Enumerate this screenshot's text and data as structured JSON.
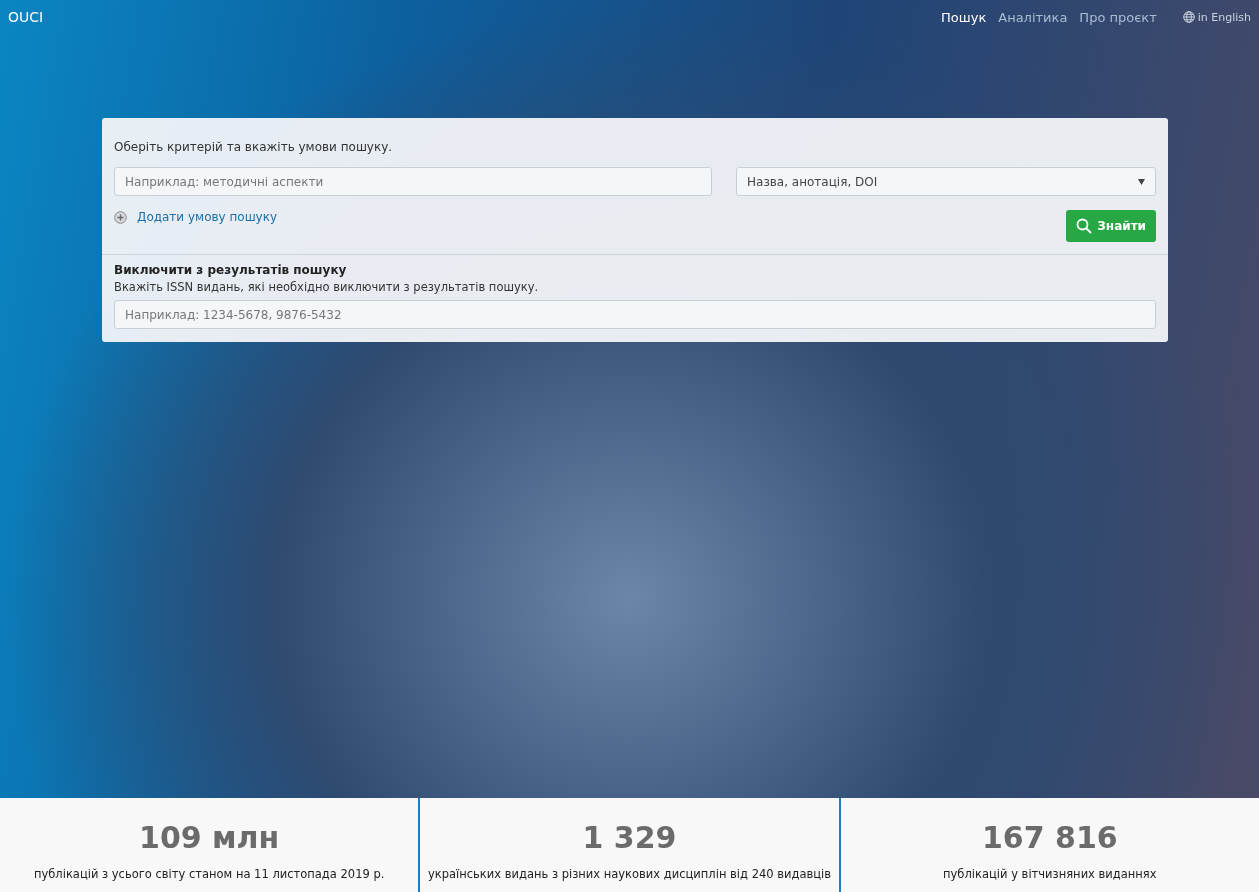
{
  "brand": "OUCI",
  "nav": [
    {
      "label": "Пошук",
      "selected": true
    },
    {
      "label": "Аналітика",
      "selected": false
    },
    {
      "label": "Про проєкт",
      "selected": false
    }
  ],
  "language": {
    "label": "in English"
  },
  "search": {
    "hint": "Оберіть критерій та вкажіть умови пошуку.",
    "query": {
      "placeholder": "Наприклад: методичні аспекти"
    },
    "criterion": {
      "value": "Назва, анотація, DOI"
    },
    "add_condition": "Додати умову пошуку",
    "submit": "Знайти"
  },
  "exclude": {
    "title": "Виключити з результатів пошуку",
    "hint": "Вкажіть ISSN видань, які необхідно виключити з результатів пошуку.",
    "issn": {
      "placeholder": "Наприклад: 1234-5678, 9876-5432"
    }
  },
  "stats": [
    {
      "value": "109 млн",
      "caption": "публікацій з усього світу станом на 11 листопада 2019 р."
    },
    {
      "value": "1 329",
      "caption": "українських видань з різних наукових дисциплін від 240 видавців"
    },
    {
      "value": "167 816",
      "caption": "публікацій у вітчизняних виданнях"
    }
  ]
}
